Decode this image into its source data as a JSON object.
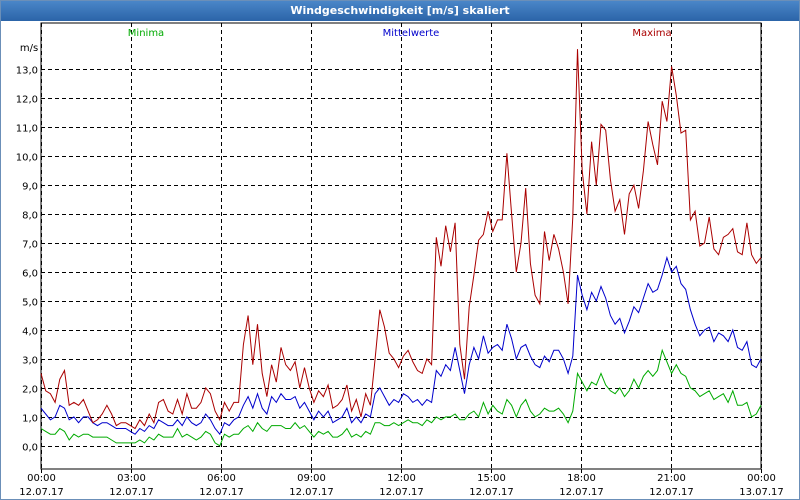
{
  "window": {
    "title": "Windgeschwindigkeit [m/s] skaliert"
  },
  "colors": {
    "minima": "#00aa00",
    "mittelwerte": "#0000cc",
    "maxima": "#aa0000",
    "grid": "#000000"
  },
  "chart_data": {
    "type": "line",
    "title": "Windgeschwindigkeit [m/s] skaliert",
    "ylabel": "m/s",
    "xlabel": "",
    "ylim": [
      -0.8,
      14.6
    ],
    "xlim_hours": [
      0,
      24
    ],
    "grid": true,
    "legend": "top",
    "yticks": [
      "0,0",
      "1,0",
      "2,0",
      "3,0",
      "4,0",
      "5,0",
      "6,0",
      "7,0",
      "8,0",
      "9,0",
      "10,0",
      "11,0",
      "12,0",
      "13,0"
    ],
    "ytick_values": [
      0,
      1,
      2,
      3,
      4,
      5,
      6,
      7,
      8,
      9,
      10,
      11,
      12,
      13
    ],
    "xticks": [
      {
        "time": "00:00",
        "date": "12.07.17"
      },
      {
        "time": "03:00",
        "date": "12.07.17"
      },
      {
        "time": "06:00",
        "date": "12.07.17"
      },
      {
        "time": "09:00",
        "date": "12.07.17"
      },
      {
        "time": "12:00",
        "date": "12.07.17"
      },
      {
        "time": "15:00",
        "date": "12.07.17"
      },
      {
        "time": "18:00",
        "date": "12.07.17"
      },
      {
        "time": "21:00",
        "date": "12.07.17"
      },
      {
        "time": "00:00",
        "date": "13.07.17"
      }
    ],
    "series": [
      {
        "name": "Maxima",
        "color": "#aa0000",
        "values": [
          2.5,
          1.9,
          1.8,
          1.5,
          2.3,
          2.6,
          1.4,
          1.5,
          1.4,
          1.6,
          1.2,
          0.8,
          0.9,
          1.1,
          1.4,
          1.1,
          0.7,
          0.8,
          0.8,
          0.7,
          0.6,
          0.9,
          0.7,
          1.1,
          0.8,
          1.5,
          1.6,
          1.2,
          1.1,
          1.6,
          1.1,
          1.8,
          1.3,
          1.3,
          1.5,
          2.0,
          1.8,
          1.2,
          0.9,
          1.5,
          1.2,
          1.5,
          1.5,
          3.5,
          4.5,
          2.8,
          4.2,
          2.5,
          1.7,
          2.8,
          2.2,
          3.4,
          2.8,
          2.6,
          2.9,
          2.0,
          2.7,
          2.0,
          1.5,
          1.9,
          1.7,
          2.1,
          1.3,
          1.4,
          1.6,
          2.1,
          1.2,
          1.6,
          1.0,
          1.8,
          1.4,
          3.0,
          4.7,
          4.1,
          3.2,
          3.0,
          2.7,
          3.1,
          3.3,
          2.9,
          2.6,
          2.5,
          3.0,
          2.8,
          7.2,
          6.2,
          7.6,
          6.7,
          7.7,
          3.5,
          2.3,
          4.8,
          5.9,
          7.1,
          7.3,
          8.1,
          7.4,
          7.8,
          7.8,
          10.1,
          8.0,
          6.0,
          7.0,
          8.9,
          6.3,
          5.2,
          4.9,
          7.4,
          6.4,
          7.3,
          6.8,
          6.0,
          4.9,
          7.9,
          13.7,
          9.5,
          8.0,
          10.5,
          9.0,
          11.1,
          10.9,
          9.2,
          8.1,
          8.5,
          7.3,
          8.7,
          9.0,
          8.2,
          9.5,
          11.2,
          10.4,
          9.7,
          11.9,
          11.2,
          13.1,
          12.1,
          10.8,
          10.9,
          7.8,
          8.1,
          6.9,
          7.0,
          7.9,
          6.8,
          6.6,
          7.2,
          7.3,
          7.5,
          6.7,
          6.6,
          7.7,
          6.6,
          6.3,
          6.5
        ]
      },
      {
        "name": "Mittelwerte",
        "color": "#0000cc",
        "values": [
          1.3,
          1.1,
          0.9,
          1.0,
          1.4,
          1.3,
          0.9,
          1.0,
          0.8,
          1.0,
          1.0,
          0.8,
          0.7,
          0.8,
          0.8,
          0.7,
          0.6,
          0.6,
          0.6,
          0.5,
          0.4,
          0.6,
          0.5,
          0.7,
          0.6,
          0.9,
          0.8,
          0.7,
          0.7,
          0.9,
          0.7,
          1.0,
          0.8,
          0.7,
          0.8,
          1.1,
          0.9,
          0.6,
          0.4,
          0.8,
          0.7,
          0.9,
          1.0,
          1.4,
          1.7,
          1.3,
          1.8,
          1.3,
          1.1,
          1.7,
          1.5,
          1.8,
          1.6,
          1.6,
          1.7,
          1.3,
          1.5,
          1.2,
          0.9,
          1.2,
          1.0,
          1.2,
          0.8,
          0.9,
          1.0,
          1.3,
          0.8,
          1.0,
          0.8,
          1.1,
          1.0,
          1.8,
          2.0,
          1.7,
          1.4,
          1.6,
          1.5,
          1.8,
          1.7,
          1.5,
          1.6,
          1.4,
          1.6,
          1.5,
          2.6,
          2.4,
          2.8,
          2.6,
          3.4,
          2.6,
          1.8,
          2.8,
          3.4,
          3.0,
          3.8,
          3.2,
          3.4,
          3.5,
          3.3,
          4.2,
          3.7,
          3.0,
          3.4,
          3.5,
          3.1,
          2.8,
          2.7,
          3.1,
          2.9,
          3.3,
          3.3,
          3.0,
          2.5,
          3.1,
          5.9,
          5.2,
          4.7,
          5.3,
          5.0,
          5.5,
          5.1,
          4.5,
          4.2,
          4.4,
          3.9,
          4.3,
          4.8,
          4.6,
          5.1,
          5.6,
          5.3,
          5.4,
          5.9,
          6.5,
          6.0,
          6.2,
          5.6,
          5.4,
          4.7,
          4.2,
          3.8,
          4.0,
          4.1,
          3.6,
          3.9,
          3.8,
          3.6,
          4.0,
          3.4,
          3.3,
          3.6,
          2.8,
          2.7,
          3.0
        ]
      },
      {
        "name": "Minima",
        "color": "#00aa00",
        "values": [
          0.6,
          0.5,
          0.4,
          0.4,
          0.6,
          0.5,
          0.2,
          0.4,
          0.3,
          0.4,
          0.4,
          0.3,
          0.3,
          0.3,
          0.3,
          0.2,
          0.1,
          0.1,
          0.1,
          0.1,
          0.1,
          0.2,
          0.1,
          0.3,
          0.2,
          0.4,
          0.3,
          0.3,
          0.3,
          0.6,
          0.3,
          0.4,
          0.3,
          0.2,
          0.3,
          0.5,
          0.4,
          0.1,
          0.0,
          0.4,
          0.3,
          0.4,
          0.4,
          0.6,
          0.7,
          0.5,
          0.8,
          0.6,
          0.5,
          0.7,
          0.7,
          0.7,
          0.6,
          0.6,
          0.8,
          0.6,
          0.7,
          0.5,
          0.3,
          0.5,
          0.4,
          0.5,
          0.3,
          0.3,
          0.4,
          0.6,
          0.3,
          0.4,
          0.3,
          0.5,
          0.4,
          0.8,
          0.8,
          0.7,
          0.7,
          0.8,
          0.7,
          0.8,
          0.9,
          0.8,
          0.8,
          0.7,
          0.9,
          0.8,
          1.0,
          0.9,
          1.0,
          1.0,
          1.1,
          0.9,
          0.9,
          1.1,
          1.2,
          1.0,
          1.5,
          1.1,
          1.4,
          1.2,
          1.1,
          1.6,
          1.4,
          1.0,
          1.4,
          1.6,
          1.2,
          1.0,
          1.1,
          1.3,
          1.2,
          1.2,
          1.3,
          1.1,
          0.8,
          1.2,
          2.5,
          2.2,
          1.9,
          2.2,
          2.1,
          2.5,
          2.1,
          1.9,
          1.8,
          2.0,
          1.7,
          1.9,
          2.3,
          2.0,
          2.4,
          2.6,
          2.4,
          2.6,
          3.3,
          2.9,
          2.5,
          2.8,
          2.5,
          2.4,
          2.0,
          1.9,
          1.7,
          1.8,
          1.9,
          1.6,
          1.7,
          1.8,
          1.5,
          1.9,
          1.4,
          1.4,
          1.5,
          1.0,
          1.1,
          1.4
        ]
      }
    ]
  }
}
